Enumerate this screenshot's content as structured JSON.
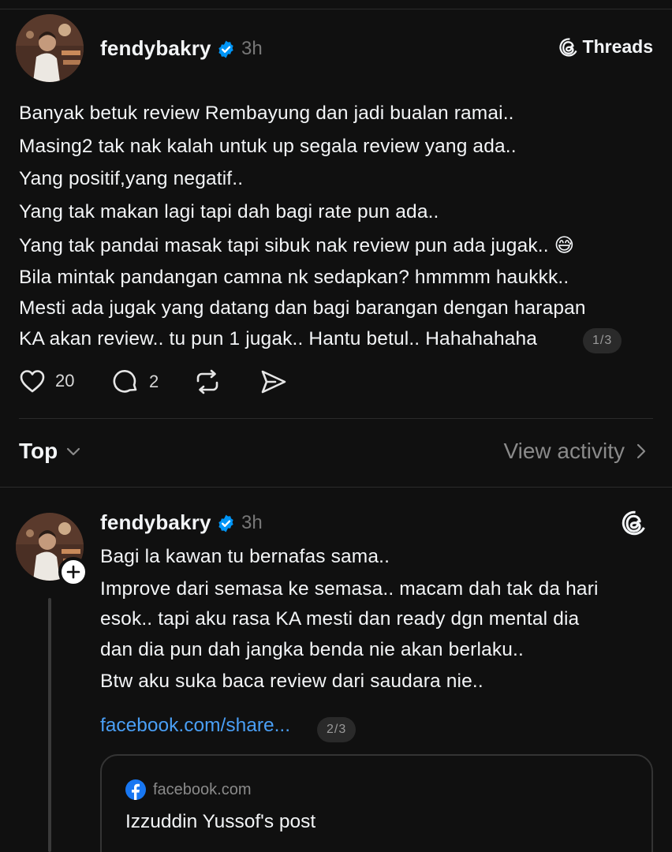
{
  "post": {
    "username": "fendybakry",
    "time": "3h",
    "badge_label": "Threads",
    "lines": [
      "Banyak betuk review Rembayung dan jadi bualan ramai..",
      "Masing2 tak nak kalah untuk up segala review yang ada..",
      "Yang positif,yang negatif..",
      "Yang tak makan lagi tapi dah bagi rate pun ada..",
      "Yang tak pandai masak tapi sibuk nak review pun ada jugak.. 😅",
      "Bila mintak pandangan camna nk sedapkan? hmmmm haukkk..",
      "Mesti ada jugak yang datang dan bagi barangan dengan harapan",
      "KA akan review.. tu pun 1 jugak.. Hantu betul.. Hahahahaha"
    ],
    "page_indicator": "1/3",
    "likes": "20",
    "replies": "2"
  },
  "sort": {
    "label": "Top",
    "view_activity": "View activity"
  },
  "reply": {
    "username": "fendybakry",
    "time": "3h",
    "lines": [
      "Bagi la kawan tu bernafas sama..",
      "Improve dari semasa ke semasa.. macam dah tak da hari",
      "esok.. tapi aku rasa KA mesti dan ready dgn mental dia",
      "dan dia pun dah jangka benda nie akan berlaku..",
      "Btw aku suka baca review dari saudara nie.."
    ],
    "link_text": "facebook.com/share...",
    "page_indicator": "2/3",
    "card": {
      "domain": "facebook.com",
      "title": "Izzuddin Yussof's post"
    }
  },
  "colors": {
    "background": "#101010",
    "text": "#f3f5f7",
    "muted": "#777777",
    "link": "#4a9ff5",
    "verified": "#0095f6"
  }
}
